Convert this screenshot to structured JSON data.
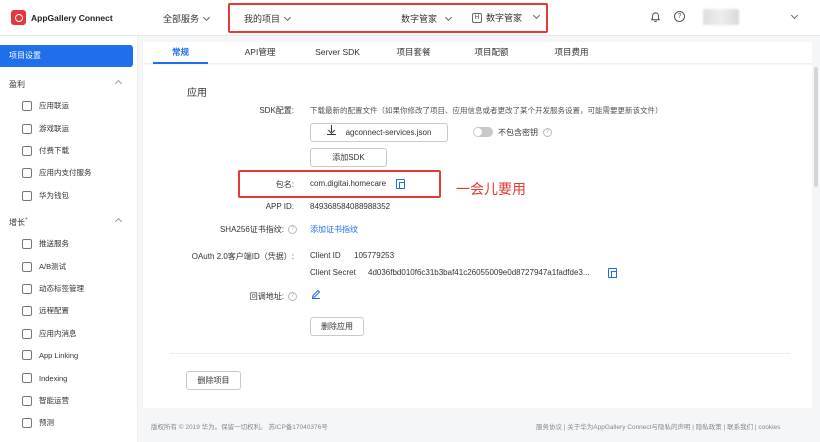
{
  "header": {
    "logo": "AppGallery Connect",
    "all_services": "全部服务",
    "project_selector": "我的项目",
    "app_selector": "数字管家",
    "platform_badge": "H",
    "platform_selector": "数字管家",
    "help_glyph": "?"
  },
  "sidebar": {
    "active": "项目设置",
    "groups": [
      {
        "label": "盈利",
        "items": [
          "应用联运",
          "游戏联运",
          "付费下载",
          "应用内支付服务",
          "华为钱包"
        ]
      },
      {
        "label": "增长",
        "items": [
          "推送服务",
          "A/B测试",
          "动态标签管理",
          "远程配置",
          "应用内消息",
          "App Linking",
          "Indexing",
          "智能运营",
          "预测"
        ]
      }
    ],
    "required_mark": "*"
  },
  "tabs": [
    "常规",
    "API管理",
    "Server SDK",
    "项目套餐",
    "项目配额",
    "项目费用"
  ],
  "main": {
    "section_title": "应用",
    "sdk_label": "SDK配置:",
    "sdk_hint": "下载最新的配置文件（如果你修改了项目、应用信息或者更改了某个开发服务设置，可能需要更新该文件）",
    "download_btn": "agconnect-services.json",
    "toggle_label": "不包含密钥",
    "add_sdk_btn": "添加SDK",
    "package_label": "包名:",
    "package_value": "com.digitai.homecare",
    "annotation": "一会儿要用",
    "appid_label": "APP ID:",
    "appid_value": "849368584088988352",
    "sha_label": "SHA256证书指纹:",
    "sha_link": "添加证书指纹",
    "oauth_label": "OAuth 2.0客户端ID（凭据）:",
    "client_id_label": "Client ID",
    "client_id_value": "105779253",
    "client_secret_label": "Client Secret",
    "client_secret_value": "4d036fbd010f6c31b3baf41c26055009e0d8727947a1fadfde3...",
    "callback_label": "回调地址:",
    "delete_app_btn": "删除应用",
    "delete_project_btn": "删除项目"
  },
  "footer": {
    "copyright": "版权所有 © 2019 华为。保留一切权利。 苏ICP备17040376号",
    "links": "服务协议 | 关于华为AppGallery Connect与隐私的声明 | 隐私政策 | 联系我们 | cookies"
  },
  "colors": {
    "accent": "#1f6fea",
    "annotation": "#e53935"
  }
}
